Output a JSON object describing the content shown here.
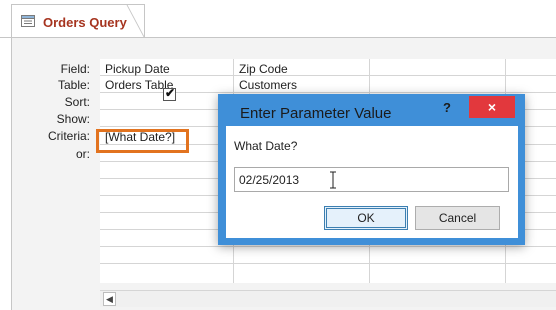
{
  "tab": {
    "label": "Orders Query",
    "icon": "query-icon"
  },
  "row_labels": [
    "Field:",
    "Table:",
    "Sort:",
    "Show:",
    "Criteria:",
    "or:"
  ],
  "columns": [
    {
      "field": "Pickup Date",
      "table": "Orders Table",
      "criteria": "[What Date?]",
      "show": true
    },
    {
      "field": "Zip Code",
      "table": "Customers"
    }
  ],
  "dialog": {
    "title": "Enter Parameter Value",
    "help": "?",
    "close": "×",
    "prompt": "What Date?",
    "value": "02/25/2013",
    "ok_label": "OK",
    "cancel_label": "Cancel"
  },
  "scroll": {
    "left_arrow": "◀"
  },
  "colors": {
    "tab_title": "#a6341f",
    "highlight": "#e2731f",
    "dialog_frame": "#3f8fd8",
    "close_button": "#e2383d"
  }
}
